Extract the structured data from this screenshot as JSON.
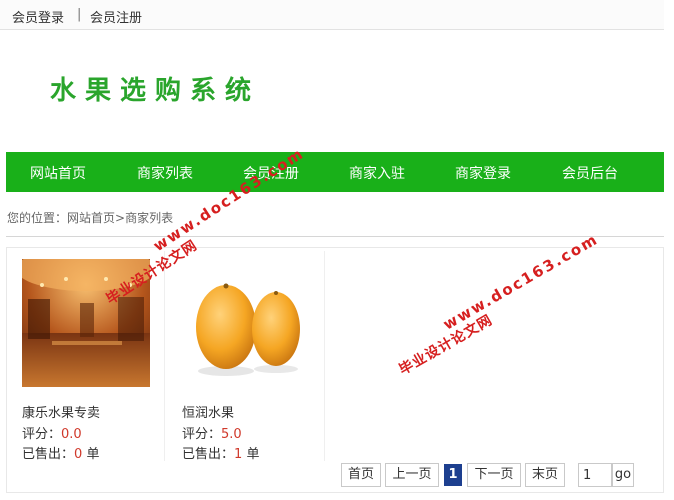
{
  "topbar": {
    "login": "会员登录",
    "separator": "|",
    "register": "会员注册"
  },
  "site_title": "水果选购系统",
  "nav": {
    "items": [
      "网站首页",
      "商家列表",
      "会员注册",
      "商家入驻",
      "商家登录",
      "会员后台"
    ]
  },
  "breadcrumb": {
    "label": "您的位置：",
    "home": "网站首页",
    "arrow": ">",
    "current": "商家列表"
  },
  "products": [
    {
      "name": "康乐水果专卖",
      "rating_label": "评分：",
      "rating": "0.0",
      "sold_label": "已售出：",
      "sold": "0",
      "unit": "单"
    },
    {
      "name": "恒润水果",
      "rating_label": "评分：",
      "rating": "5.0",
      "sold_label": "已售出：",
      "sold": "1",
      "unit": "单"
    }
  ],
  "pager": {
    "first": "首页",
    "prev": "上一页",
    "current": "1",
    "next": "下一页",
    "last": "末页",
    "page_input": "1",
    "go": "go"
  },
  "watermark": {
    "text": "毕业设计论文网",
    "url": "www.doc163.com"
  },
  "colors": {
    "nav_bg": "#19b019",
    "title": "#2aa52c",
    "pager_current": "#1d3f8f",
    "value_red": "#d0392b",
    "watermark": "#d61f1f"
  }
}
